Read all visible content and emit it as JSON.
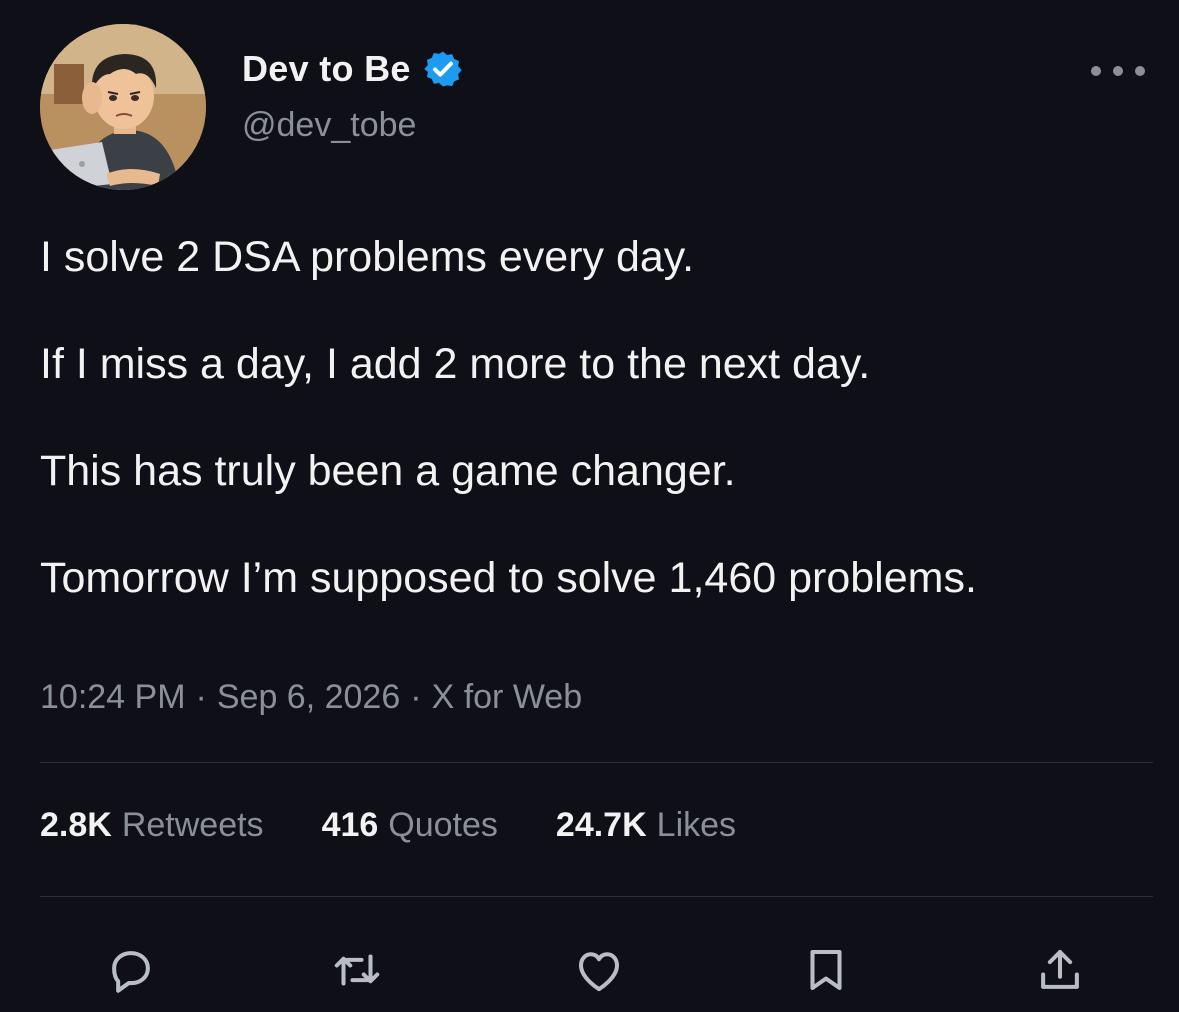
{
  "author": {
    "display_name": "Dev to Be",
    "handle": "@dev_tobe",
    "verified": true,
    "verified_color": "#1d9bf0"
  },
  "tweet": {
    "lines": [
      "I solve 2 DSA problems every day.",
      "If I miss a day, I add 2 more to the next day.",
      "This has truly been a game changer.",
      "Tomorrow I’m supposed to solve 1,460 problems."
    ]
  },
  "meta": {
    "time": "10:24 PM",
    "date": "Sep 6, 2026",
    "source": "X for Web",
    "separator": "·"
  },
  "stats": {
    "retweets": {
      "count": "2.8K",
      "label": "Retweets"
    },
    "quotes": {
      "count": "416",
      "label": "Quotes"
    },
    "likes": {
      "count": "24.7K",
      "label": "Likes"
    }
  },
  "actions": {
    "icons": [
      "reply-icon",
      "retweet-icon",
      "like-icon",
      "bookmark-icon",
      "share-icon"
    ]
  },
  "colors": {
    "background": "#0f0f17",
    "text": "#f2f2f2",
    "secondary_text": "#8b9098",
    "divider": "#2a2e35"
  }
}
